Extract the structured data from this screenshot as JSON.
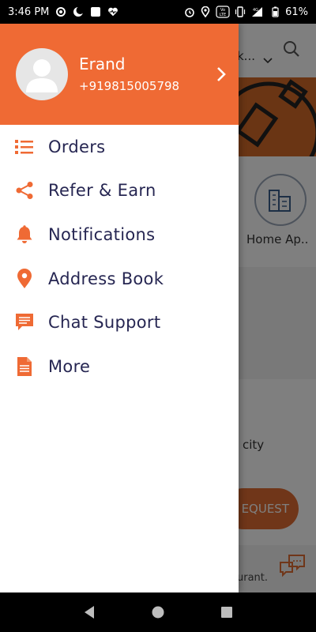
{
  "status_bar": {
    "time": "3:46 PM",
    "battery": "61%",
    "network": "4G",
    "volte": "Vo LTE",
    "icons_left": [
      "circle-dot-icon",
      "moon-icon",
      "square-icon",
      "heart-pulse-icon"
    ],
    "icons_right": [
      "alarm-icon",
      "location-pin-icon",
      "volte-icon",
      "vibrate-icon",
      "signal-icon",
      "battery-icon"
    ]
  },
  "drawer": {
    "user_name": "Erand",
    "user_phone": "+919815005798",
    "menu": [
      {
        "label": "Orders",
        "icon": "list-icon"
      },
      {
        "label": "Refer & Earn",
        "icon": "share-icon"
      },
      {
        "label": "Notifications",
        "icon": "bell-icon"
      },
      {
        "label": "Address Book",
        "icon": "map-pin-icon"
      },
      {
        "label": "Chat Support",
        "icon": "chat-icon"
      },
      {
        "label": "More",
        "icon": "document-icon"
      }
    ]
  },
  "background": {
    "location_text": "k...",
    "category_label": "Home Ap..",
    "card_text": "city",
    "request_button": "EQUEST",
    "footer_text": "urant."
  },
  "nav_bar": {
    "icons": [
      "back-icon",
      "home-icon",
      "recents-icon"
    ]
  },
  "colors": {
    "accent": "#ef6a34",
    "menu_text": "#262652",
    "header_text": "#ffffff"
  }
}
